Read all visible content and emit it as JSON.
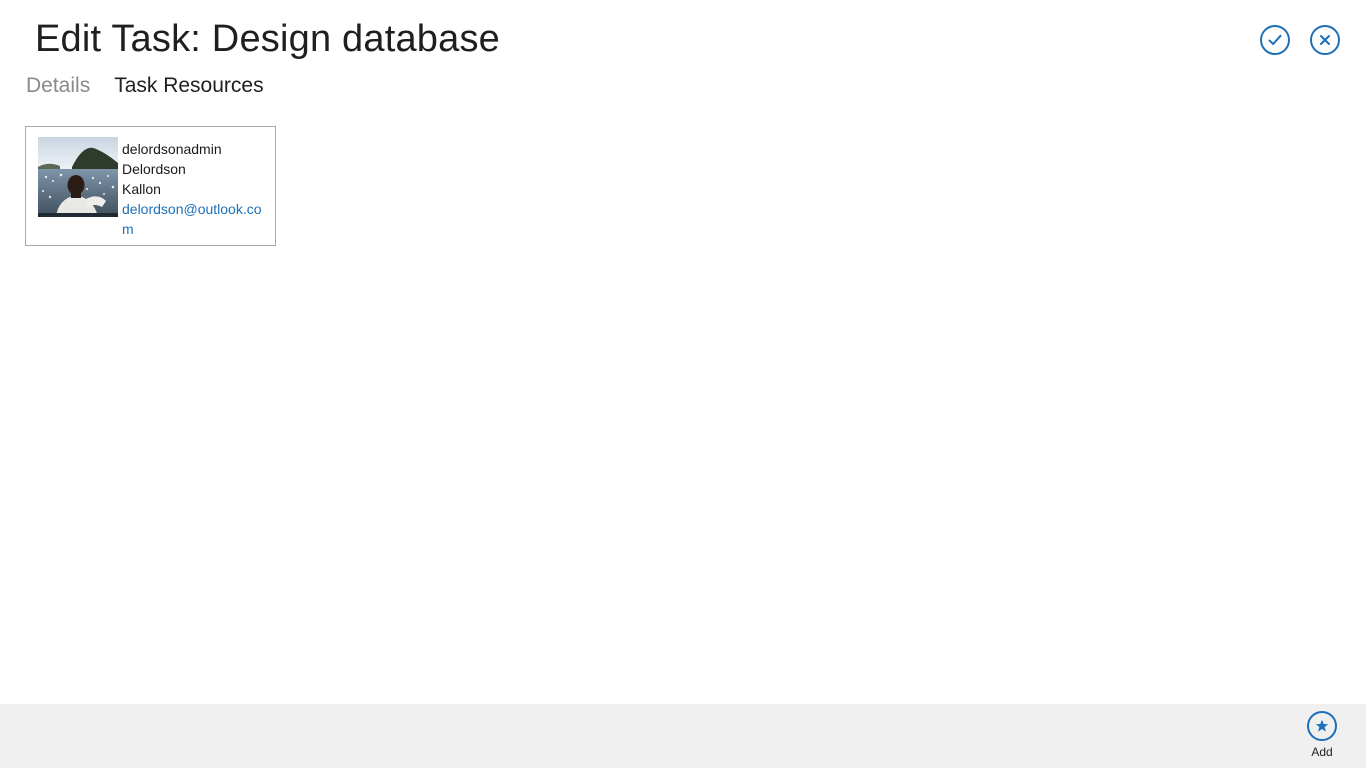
{
  "page": {
    "title": "Edit Task: Design database"
  },
  "header_actions": {
    "save_icon": "checkmark-icon",
    "cancel_icon": "close-icon",
    "accent_color": "#1d6fb8"
  },
  "tabs": [
    {
      "label": "Details",
      "active": false
    },
    {
      "label": "Task Resources",
      "active": true
    }
  ],
  "resources": [
    {
      "username": "delordsonadmin",
      "first_name": "Delordson",
      "last_name": "Kallon",
      "email": "delordson@outlook.com",
      "avatar_icon": "user-photo"
    }
  ],
  "app_bar": {
    "add_label": "Add",
    "add_icon": "star-icon",
    "background": "#f0f0f0"
  }
}
